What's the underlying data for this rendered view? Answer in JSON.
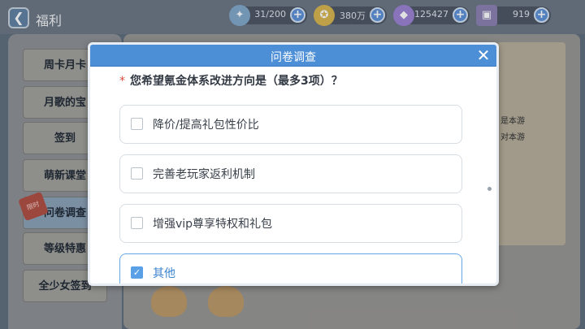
{
  "header": {
    "back_icon": "back-arrow-icon",
    "title": "福利"
  },
  "resources": [
    {
      "icon": "stamina-wing-icon",
      "value": "31/200"
    },
    {
      "icon": "gold-coin-icon",
      "value": "380万"
    },
    {
      "icon": "gem-icon",
      "value": "125427"
    },
    {
      "icon": "ticket-icon",
      "value": "919"
    }
  ],
  "sidebar": {
    "items": [
      {
        "label": "周卡月卡"
      },
      {
        "label": "月歌的宝"
      },
      {
        "label": "签到"
      },
      {
        "label": "萌新课堂"
      },
      {
        "label": "问卷调查"
      },
      {
        "label": "等级特惠"
      },
      {
        "label": "全少女签到"
      }
    ],
    "limited_badge": "限时"
  },
  "background_text": {
    "line1": "是本游",
    "line2": "对本游"
  },
  "modal": {
    "title": "问卷调查",
    "close_icon": "close-x-icon",
    "question_required_mark": "*",
    "question": "您希望氪金体系改进方向是（最多3项）？",
    "options": [
      {
        "label": "降价/提高礼包性价比",
        "checked": false
      },
      {
        "label": "完善老玩家返利机制",
        "checked": false
      },
      {
        "label": "增强vip尊享特权和礼包",
        "checked": false
      },
      {
        "label": "其他",
        "checked": true
      }
    ]
  },
  "colors": {
    "accent": "#4d8fd6",
    "checked": "#5aa0e6",
    "required": "#d84a3a"
  }
}
